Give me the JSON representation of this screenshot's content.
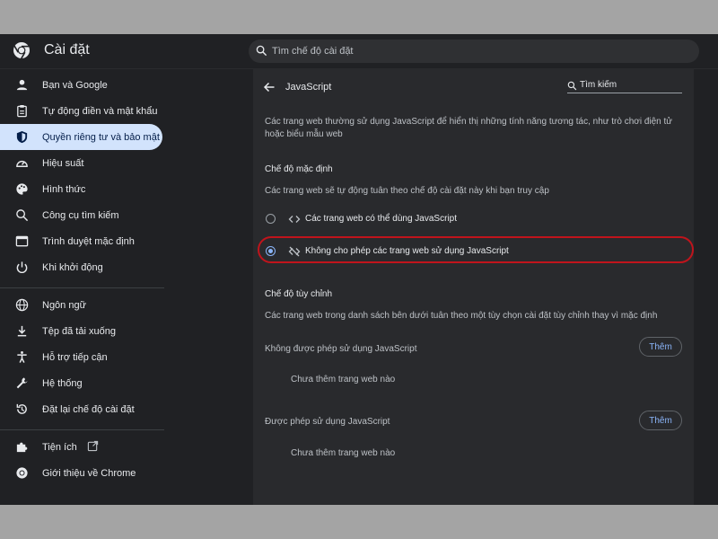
{
  "header": {
    "app_title": "Cài đặt",
    "search_placeholder": "Tìm chế độ cài đặt"
  },
  "sidebar": {
    "items": [
      {
        "label": "Bạn và Google",
        "icon": "person-icon"
      },
      {
        "label": "Tự động điền và mật khẩu",
        "icon": "clipboard-icon"
      },
      {
        "label": "Quyền riêng tư và bảo mật",
        "icon": "shield-icon",
        "active": true
      },
      {
        "label": "Hiệu suất",
        "icon": "speedometer-icon"
      },
      {
        "label": "Hình thức",
        "icon": "palette-icon"
      },
      {
        "label": "Công cụ tìm kiếm",
        "icon": "search-icon"
      },
      {
        "label": "Trình duyệt mặc định",
        "icon": "browser-icon"
      },
      {
        "label": "Khi khởi động",
        "icon": "power-icon"
      },
      {
        "label": "Ngôn ngữ",
        "icon": "globe-icon"
      },
      {
        "label": "Tệp đã tải xuống",
        "icon": "download-icon"
      },
      {
        "label": "Hỗ trợ tiếp cận",
        "icon": "accessibility-icon"
      },
      {
        "label": "Hệ thống",
        "icon": "wrench-icon"
      },
      {
        "label": "Đặt lại chế độ cài đặt",
        "icon": "reset-icon"
      },
      {
        "label": "Tiện ích",
        "icon": "puzzle-icon"
      },
      {
        "label": "Giới thiệu về Chrome",
        "icon": "chrome-icon"
      }
    ]
  },
  "content": {
    "title": "JavaScript",
    "search_placeholder": "Tìm kiếm",
    "description": "Các trang web thường sử dụng JavaScript để hiển thị những tính năng tương tác, như trò chơi điện tử hoặc biểu mẫu web",
    "default_section": {
      "heading": "Chế độ mặc định",
      "subtitle": "Các trang web sẽ tự động tuân theo chế độ cài đặt này khi bạn truy cập",
      "options": [
        {
          "label": "Các trang web có thể dùng JavaScript",
          "icon": "code-icon",
          "selected": false
        },
        {
          "label": "Không cho phép các trang web sử dụng JavaScript",
          "icon": "code-off-icon",
          "selected": true
        }
      ]
    },
    "custom_section": {
      "heading": "Chế độ tùy chỉnh",
      "subtitle": "Các trang web trong danh sách bên dưới tuân theo một tùy chọn cài đặt tùy chỉnh thay vì mặc định",
      "blocked": {
        "label": "Không được phép sử dụng JavaScript",
        "add_label": "Thêm",
        "empty_text": "Chưa thêm trang web nào"
      },
      "allowed": {
        "label": "Được phép sử dụng JavaScript",
        "add_label": "Thêm",
        "empty_text": "Chưa thêm trang web nào"
      }
    }
  },
  "colors": {
    "background": "#202124",
    "panel": "#292a2d",
    "accent": "#8ab4f8",
    "active_nav": "#d2e3fc",
    "highlight_border": "#c0141c"
  }
}
